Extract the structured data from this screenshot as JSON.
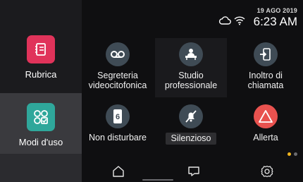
{
  "sidebar": {
    "items": [
      {
        "label": "Rubrica",
        "icon": "address-book-icon",
        "color": "#e0335a"
      },
      {
        "label": "Modi d'uso",
        "icon": "modes-grid-icon",
        "color": "#2fa79b"
      }
    ]
  },
  "status": {
    "date": "19 AGO 2019",
    "time": "6:23 AM",
    "icons": [
      "cloud-icon",
      "wifi-icon"
    ]
  },
  "tiles": [
    {
      "label": "Segreteria videocitofonica",
      "icon": "voicemail-icon"
    },
    {
      "label": "Studio professionale",
      "icon": "office-desk-icon"
    },
    {
      "label": "Inoltro di chiamata",
      "icon": "call-forward-icon"
    },
    {
      "label": "Non disturbare",
      "icon": "do-not-disturb-icon"
    },
    {
      "label": "Silenzioso",
      "icon": "mute-icon"
    },
    {
      "label": "Allerta",
      "icon": "alert-icon",
      "color": "#e8524f"
    }
  ],
  "pager": {
    "active_color": "#f2b51d",
    "inactive_color": "#6b6b6f"
  },
  "navbar": {
    "items": [
      "home-icon",
      "message-icon",
      "settings-icon"
    ]
  }
}
